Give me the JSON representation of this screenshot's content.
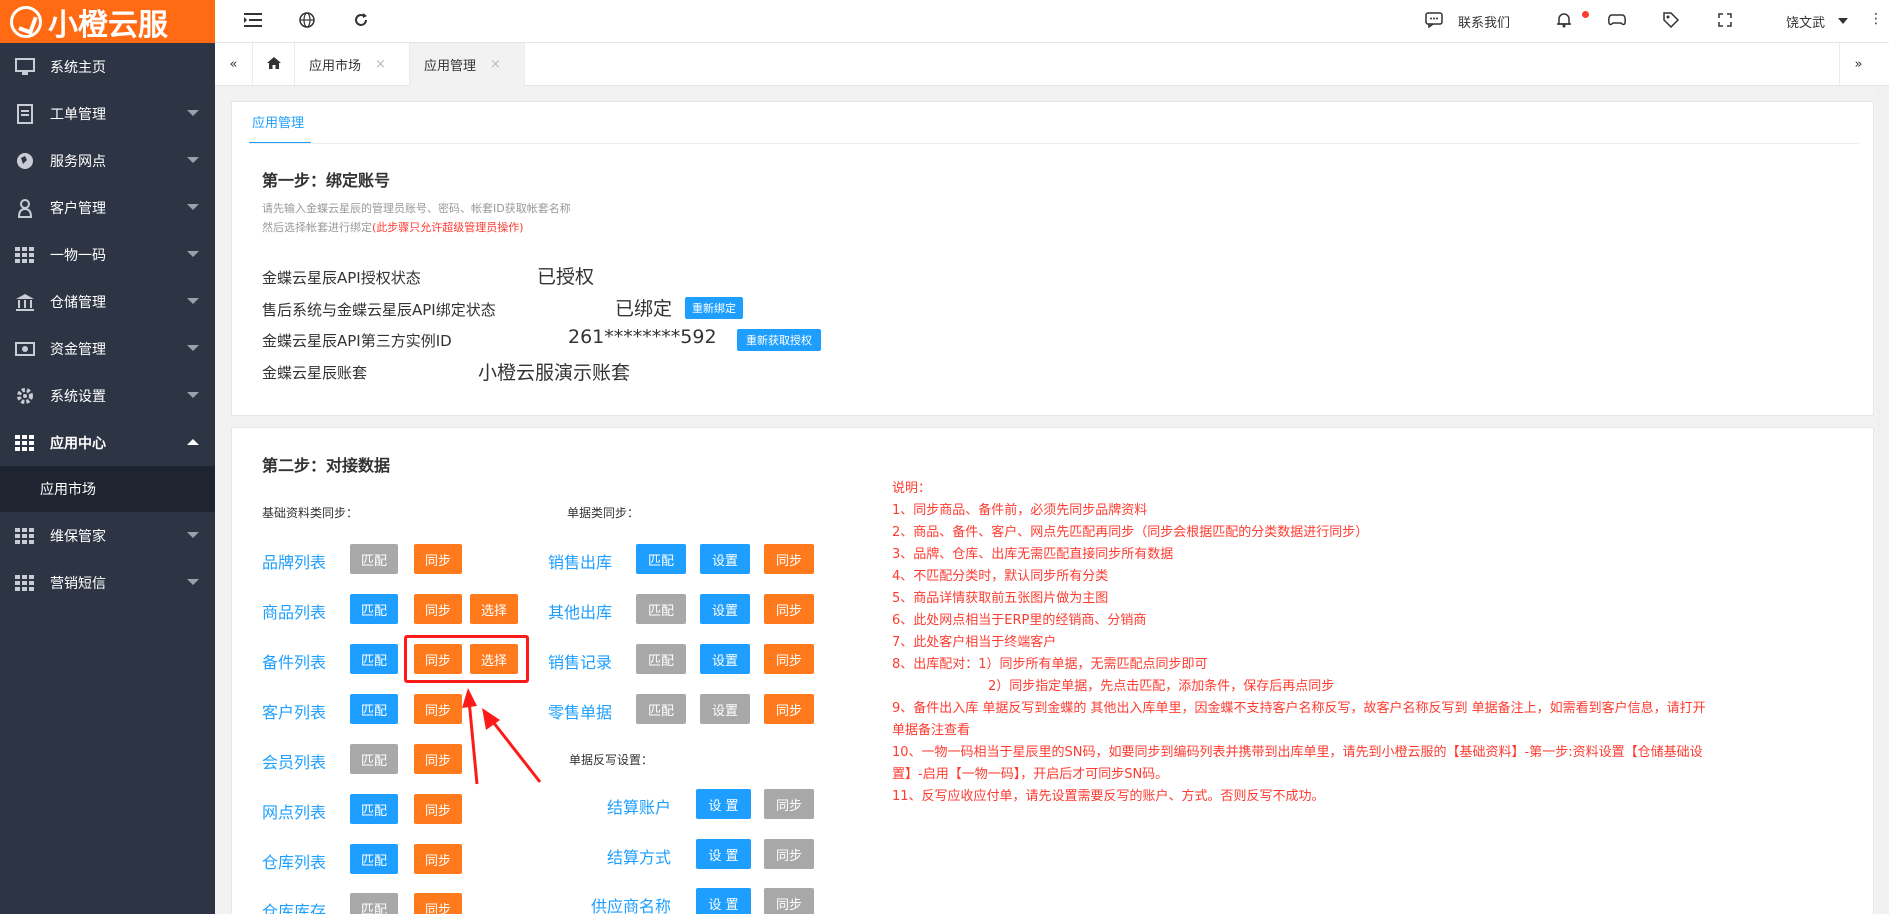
{
  "brand": {
    "logo_text": "小橙云服"
  },
  "sidebar": {
    "items": [
      {
        "label": "系统主页",
        "icon": "monitor-icon",
        "has_caret": false
      },
      {
        "label": "工单管理",
        "icon": "document-icon",
        "has_caret": true
      },
      {
        "label": "服务网点",
        "icon": "globe-icon",
        "has_caret": true
      },
      {
        "label": "客户管理",
        "icon": "user-icon",
        "has_caret": true
      },
      {
        "label": "一物一码",
        "icon": "grid-icon",
        "has_caret": true
      },
      {
        "label": "仓储管理",
        "icon": "bank-icon",
        "has_caret": true
      },
      {
        "label": "资金管理",
        "icon": "money-icon",
        "has_caret": true
      },
      {
        "label": "系统设置",
        "icon": "gear-icon",
        "has_caret": true
      },
      {
        "label": "应用中心",
        "icon": "grid-icon",
        "has_caret": true,
        "expanded": true
      }
    ],
    "sub_item": "应用市场",
    "bottom_items": [
      {
        "label": "维保管家",
        "icon": "grid-icon"
      },
      {
        "label": "营销短信",
        "icon": "grid-icon"
      }
    ]
  },
  "topbar": {
    "contact": "联系我们",
    "user": "饶文武"
  },
  "tabs": {
    "home_icon": "home-icon",
    "items": [
      {
        "label": "应用市场",
        "close": "×"
      },
      {
        "label": "应用管理",
        "close": "×"
      }
    ]
  },
  "panel_tab": "应用管理",
  "step1": {
    "title": "第一步：绑定账号",
    "hint1": "请先输入金蝶云星辰的管理员账号、密码、帐套ID获取帐套名称",
    "hint2": "然后选择帐套进行绑定",
    "hint2_red": "(此步骤只允许超级管理员操作)",
    "rows": [
      {
        "label": "金蝶云星辰API授权状态",
        "value": "已授权",
        "button": ""
      },
      {
        "label": "售后系统与金蝶云星辰API绑定状态",
        "value": "已绑定",
        "button": "重新绑定"
      },
      {
        "label": "金蝶云星辰API第三方实例ID",
        "value": "261********592",
        "button": "重新获取授权"
      },
      {
        "label": "金蝶云星辰账套",
        "value": "小橙云服演示账套",
        "button": ""
      }
    ]
  },
  "step2": {
    "title": "第二步：对接数据",
    "basic_title": "基础资料类同步：",
    "doc_title": "单据类同步：",
    "writeback_title": "单据反写设置：",
    "basic": [
      {
        "label": "品牌列表",
        "match": "匹配",
        "match_color": "gray",
        "sync": "同步",
        "select": ""
      },
      {
        "label": "商品列表",
        "match": "匹配",
        "match_color": "blue",
        "sync": "同步",
        "select": "选择"
      },
      {
        "label": "备件列表",
        "match": "匹配",
        "match_color": "blue",
        "sync": "同步",
        "select": "选择"
      },
      {
        "label": "客户列表",
        "match": "匹配",
        "match_color": "blue",
        "sync": "同步",
        "select": ""
      },
      {
        "label": "会员列表",
        "match": "匹配",
        "match_color": "gray",
        "sync": "同步",
        "select": ""
      },
      {
        "label": "网点列表",
        "match": "匹配",
        "match_color": "blue",
        "sync": "同步",
        "select": ""
      },
      {
        "label": "仓库列表",
        "match": "匹配",
        "match_color": "blue",
        "sync": "同步",
        "select": ""
      },
      {
        "label": "仓库库存",
        "match": "匹配",
        "match_color": "gray",
        "sync": "同步",
        "select": ""
      }
    ],
    "docs": [
      {
        "label": "销售出库",
        "match": "匹配",
        "match_color": "blue",
        "setting": "设置",
        "setting_color": "blue",
        "sync": "同步"
      },
      {
        "label": "其他出库",
        "match": "匹配",
        "match_color": "gray",
        "setting": "设置",
        "setting_color": "blue",
        "sync": "同步"
      },
      {
        "label": "销售记录",
        "match": "匹配",
        "match_color": "gray",
        "setting": "设置",
        "setting_color": "blue",
        "sync": "同步"
      },
      {
        "label": "零售单据",
        "match": "匹配",
        "match_color": "gray",
        "setting": "设置",
        "setting_color": "gray",
        "sync": "同步"
      }
    ],
    "writeback": [
      {
        "label": "结算账户",
        "setting": "设 置",
        "sync": "同步"
      },
      {
        "label": "结算方式",
        "setting": "设 置",
        "sync": "同步"
      },
      {
        "label": "供应商名称",
        "setting": "设 置",
        "sync": "同步"
      }
    ],
    "notes": [
      "说明：",
      "1、同步商品、备件前，必须先同步品牌资料",
      "2、商品、备件、客户、网点先匹配再同步（同步会根据匹配的分类数据进行同步）",
      "3、品牌、仓库、出库无需匹配直接同步所有数据",
      "4、不匹配分类时，默认同步所有分类",
      "5、商品详情获取前五张图片做为主图",
      "6、此处网点相当于ERP里的经销商、分销商",
      "7、此处客户相当于终端客户",
      "8、出库配对：1）同步所有单据，无需匹配点同步即可",
      "2）同步指定单据，先点击匹配，添加条件，保存后再点同步",
      "9、备件出入库 单据反写到金蝶的 其他出入库单里，因金蝶不支持客户名称反写，故客户名称反写到 单据备注上，如需看到客户信息，请打开",
      "单据备注查看",
      "10、一物一码相当于星辰里的SN码，如要同步到编码列表并携带到出库单里，请先到小橙云服的【基础资料】-第一步:资料设置【仓储基础设",
      "置】-启用【一物一码】，开启后才可同步SN码。",
      "11、反写应收应付单，请先设置需要反写的账户、方式。否则反写不成功。"
    ]
  },
  "colors": {
    "sidebar": "#2d3443",
    "brand": "#ff6a13",
    "blue": "#1e9fff",
    "orange": "#ff7a1c",
    "gray": "#a8a8a8",
    "red": "#ff3b30"
  }
}
